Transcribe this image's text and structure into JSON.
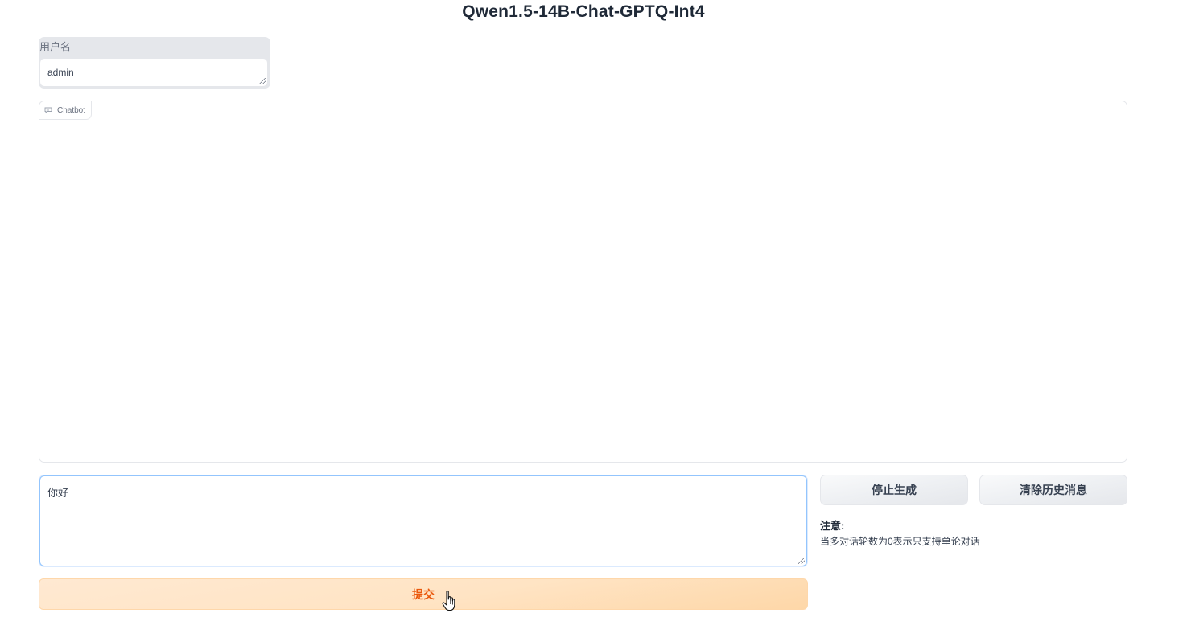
{
  "title": "Qwen1.5-14B-Chat-GPTQ-Int4",
  "username": {
    "label": "用户名",
    "value": "admin"
  },
  "chatbot": {
    "label": "Chatbot",
    "icon": "chat-icon"
  },
  "message": {
    "value": "你好"
  },
  "buttons": {
    "submit": "提交",
    "stop": "停止生成",
    "clear": "清除历史消息"
  },
  "note": {
    "title": "注意:",
    "text": "当多对话轮数为0表示只支持单论对话"
  },
  "colors": {
    "submit_text": "#ea580c",
    "submit_bg": "#ffe4c4",
    "input_focus_border": "#93c5fd"
  }
}
